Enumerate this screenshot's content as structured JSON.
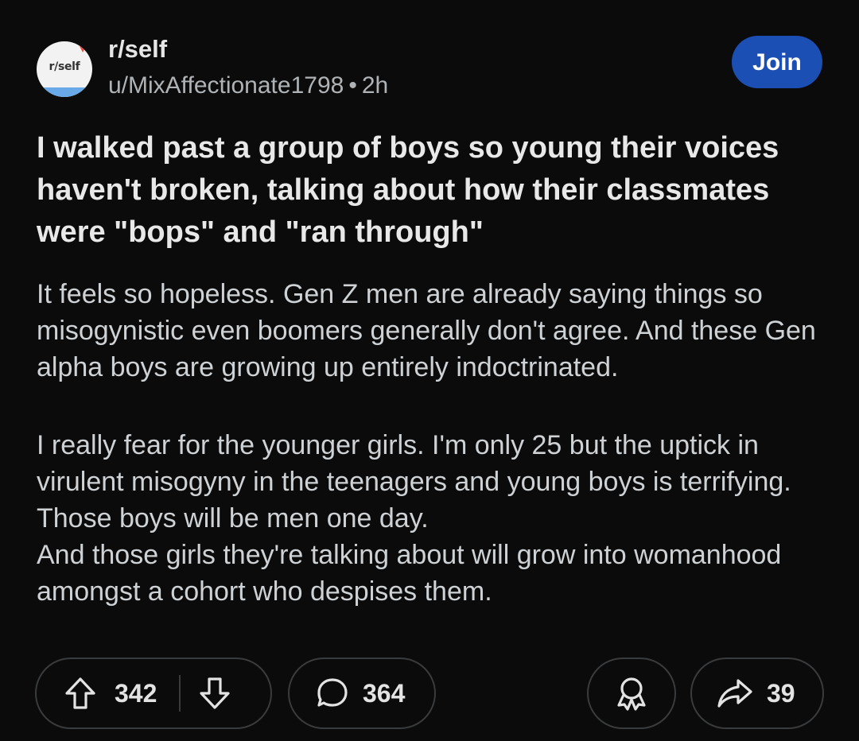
{
  "post": {
    "subreddit": "r/self",
    "avatar_text": "r/self",
    "author": "u/MixAffectionate1798",
    "separator": "•",
    "time_ago": "2h",
    "join_label": "Join",
    "title": "I walked past a group of boys so young their voices haven't broken, talking about how their classmates were \"bops\" and \"ran through\"",
    "body": [
      "It feels so hopeless. Gen Z men are already saying things so misogynistic even boomers generally don't agree. And these Gen alpha boys are growing up entirely indoctrinated.",
      "I really fear for the younger girls. I'm only 25 but the uptick in virulent misogyny in the teenagers and young boys is terrifying. Those boys will be men one day.\nAnd those girls they're talking about will grow into womanhood amongst a cohort who despises them."
    ]
  },
  "actions": {
    "upvote_count": "342",
    "comment_count": "364",
    "share_count": "39",
    "icons": [
      "upvote-icon",
      "downvote-icon",
      "comment-icon",
      "award-icon",
      "share-icon"
    ]
  },
  "colors": {
    "background": "#0b0b0c",
    "join_button": "#1c4fb4",
    "pill_border": "#3a3b3c"
  }
}
